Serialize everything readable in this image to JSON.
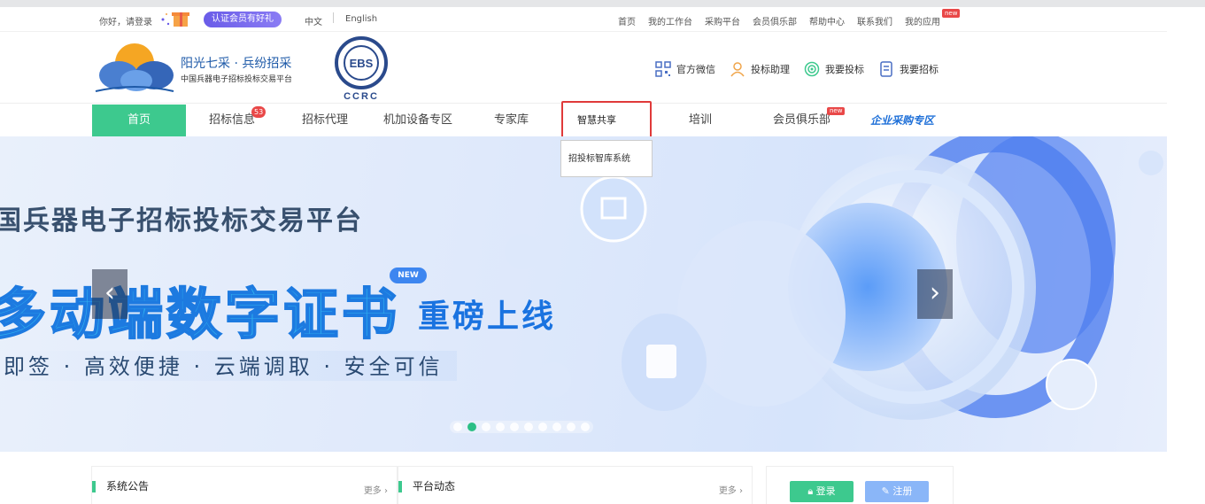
{
  "topbar": {
    "greeting": "你好，请登录",
    "member_badge": "认证会员有好礼",
    "lang_zh": "中文",
    "lang_en": "English",
    "links": [
      "首页",
      "我的工作台",
      "采购平台",
      "会员俱乐部",
      "帮助中心",
      "联系我们",
      "我的应用"
    ],
    "new_tag": "new"
  },
  "header": {
    "logo_title": "阳光七采 · 兵纷招采",
    "logo_subtitle": "中国兵器电子招标投标交易平台",
    "ebs_text": "EBS",
    "ccrc_text": "CCRC",
    "links": [
      {
        "label": "官方微信",
        "icon": "qrcode-icon"
      },
      {
        "label": "投标助理",
        "icon": "user-icon"
      },
      {
        "label": "我要投标",
        "icon": "target-icon"
      },
      {
        "label": "我要招标",
        "icon": "document-icon"
      }
    ]
  },
  "nav": {
    "items": [
      "首页",
      "招标信息",
      "招标代理",
      "机加设备专区",
      "专家库",
      "智慧共享",
      "培训",
      "会员俱乐部",
      "企业采购专区"
    ],
    "bid_count": "53",
    "club_new": "new",
    "dropdown_item": "招投标智库系统"
  },
  "banner": {
    "line1": "国兵器电子招标投标交易平台",
    "line2": "多动端数字证书",
    "line2_suffix": "重磅上线",
    "new_badge": "NEW",
    "line3": "即签 · 高效便捷 · 云端调取 · 安全可信",
    "prev": "‹",
    "next": "›",
    "slide_count": 10,
    "active_slide": 2
  },
  "panels": {
    "notice_title": "系统公告",
    "notice_more": "更多 ›",
    "news_title": "平台动态",
    "news_more": "更多 ›",
    "login_label": "登录",
    "register_label": "注册"
  },
  "colors": {
    "accent_green": "#3dc98e",
    "brand_blue": "#1e5aa8",
    "highlight_red": "#e03a3a"
  }
}
